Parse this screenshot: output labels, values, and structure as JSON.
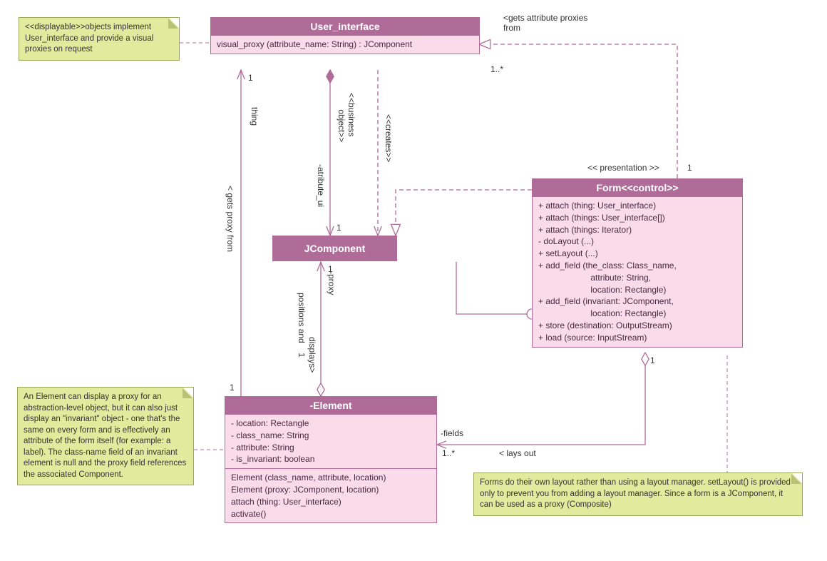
{
  "classes": {
    "user_interface": {
      "title": "User_interface",
      "ops": "visual_proxy (attribute_name: String) : JComponent"
    },
    "jcomponent": {
      "title": "JComponent"
    },
    "form": {
      "title": "Form<<control>>",
      "ops": "+ attach (thing: User_interface)\n+ attach (things: User_interface[])\n+ attach (things: Iterator)\n- doLayout (...)\n+ setLayout (...)\n+ add_field (the_class: Class_name,\n                      attribute: String,\n                      location: Rectangle)\n+ add_field (invariant: JComponent,\n                      location: Rectangle)\n+ store (destination: OutputStream)\n+ load (source: InputStream)"
    },
    "element": {
      "title": "-Element",
      "attrs": "- location: Rectangle\n- class_name: String\n- attribute: String\n- is_invariant: boolean",
      "ops": "Element (class_name, attribute, location)\nElement (proxy: JComponent, location)\nattach (thing: User_interface)\nactivate()"
    }
  },
  "notes": {
    "displayable": "<<displayable>>objects implement User_interface and provide a visual proxies on request",
    "element_note": "An Element can display a proxy for an abstraction-level object, but it can also just display an \"invariant\" object - one that's the same on every form and is effectively an attribute of the form itself (for example: a label). The class-name field of an invariant element is null and the proxy field references the associated Component.",
    "form_note": "Forms do their own layout rather than using a layout manager. setLayout() is provided only to prevent you from adding a layout manager.\nSince a form is a JComponent, it can be used as a proxy (Composite)"
  },
  "labels": {
    "gets_attribute_proxies": "<gets attribute proxies\nfrom",
    "one_star_top": "1..*",
    "presentation": "<< presentation >>",
    "one_right": "1",
    "thing": "thing",
    "one_ui_left": "1",
    "gets_proxy_from": "< gets proxy from",
    "business_object": "<<business\n       object>>",
    "atribute_ui": "-atribute_ui",
    "creates": "<<creates>>",
    "one_mid_left": "1",
    "positions_and": "positions and    1",
    "displays": "displays>",
    "proxy": "-proxy",
    "one_bottom_left": "1",
    "fields": "-fields",
    "lays_out": "< lays out",
    "one_star_bottom": "1..*",
    "one_under_form": "1",
    "one_mid_right": "1"
  },
  "chart_data": {
    "type": "table",
    "diagram_type": "UML Class Diagram",
    "classes": [
      {
        "name": "User_interface",
        "stereotype": null,
        "attributes": [],
        "operations": [
          {
            "visibility": null,
            "signature": "visual_proxy(attribute_name: String) : JComponent"
          }
        ]
      },
      {
        "name": "JComponent",
        "stereotype": null,
        "attributes": [],
        "operations": []
      },
      {
        "name": "Form",
        "stereotype": "<<control>>",
        "attributes": [],
        "operations": [
          {
            "visibility": "+",
            "signature": "attach(thing: User_interface)"
          },
          {
            "visibility": "+",
            "signature": "attach(things: User_interface[])"
          },
          {
            "visibility": "+",
            "signature": "attach(things: Iterator)"
          },
          {
            "visibility": "-",
            "signature": "doLayout(...)"
          },
          {
            "visibility": "+",
            "signature": "setLayout(...)"
          },
          {
            "visibility": "+",
            "signature": "add_field(the_class: Class_name, attribute: String, location: Rectangle)"
          },
          {
            "visibility": "+",
            "signature": "add_field(invariant: JComponent, location: Rectangle)",
            "italic": true
          },
          {
            "visibility": "+",
            "signature": "store(destination: OutputStream)",
            "italic": true
          },
          {
            "visibility": "+",
            "signature": "load(source: InputStream)",
            "italic": true
          }
        ]
      },
      {
        "name": "Element",
        "visibility_prefix": "-",
        "attributes": [
          {
            "visibility": "-",
            "name": "location",
            "type": "Rectangle"
          },
          {
            "visibility": "-",
            "name": "class_name",
            "type": "String"
          },
          {
            "visibility": "-",
            "name": "attribute",
            "type": "String"
          },
          {
            "visibility": "-",
            "name": "is_invariant",
            "type": "boolean"
          }
        ],
        "operations": [
          {
            "visibility": null,
            "signature": "Element(class_name, attribute, location)"
          },
          {
            "visibility": null,
            "signature": "Element(proxy: JComponent, location)"
          },
          {
            "visibility": null,
            "signature": "attach(thing: User_interface)"
          },
          {
            "visibility": null,
            "signature": "activate()"
          }
        ]
      }
    ],
    "relationships": [
      {
        "from": "Form",
        "to": "User_interface",
        "type": "dependency",
        "label": "gets attribute proxies from",
        "multiplicity_to": "1..*",
        "direction": "to"
      },
      {
        "from": "Form",
        "to": "JComponent",
        "type": "realization/dependency",
        "label": "<< presentation >>",
        "multiplicity_from": "1"
      },
      {
        "from": "Form",
        "to": "JComponent",
        "type": "association-interface-lollipop",
        "via": "open circle"
      },
      {
        "from": "User_interface",
        "to": "JComponent",
        "type": "composition",
        "stereotype": "<<business object>>",
        "role_to": "atribute_ui",
        "multiplicity_to": "1"
      },
      {
        "from": "User_interface",
        "to": "JComponent",
        "type": "dependency",
        "stereotype": "<<creates>>"
      },
      {
        "from": "Element",
        "to": "User_interface",
        "type": "association",
        "label": "gets proxy from",
        "role_to": "thing",
        "multiplicity_from": "1",
        "multiplicity_to": "1",
        "direction": "to"
      },
      {
        "from": "Element",
        "to": "JComponent",
        "type": "aggregation",
        "label": "positions and displays",
        "role_to": "proxy",
        "multiplicity_from": "1",
        "multiplicity_to": "1",
        "direction": "to"
      },
      {
        "from": "Form",
        "to": "Element",
        "type": "aggregation",
        "label": "lays out",
        "role_to": "fields",
        "multiplicity_from": "1",
        "multiplicity_to": "1..*",
        "direction": "to"
      },
      {
        "from": "Note(displayable)",
        "to": "User_interface",
        "type": "note-anchor"
      },
      {
        "from": "Note(element_note)",
        "to": "Element",
        "type": "note-anchor"
      },
      {
        "from": "Note(form_note)",
        "to": "Form",
        "type": "note-anchor"
      }
    ]
  }
}
